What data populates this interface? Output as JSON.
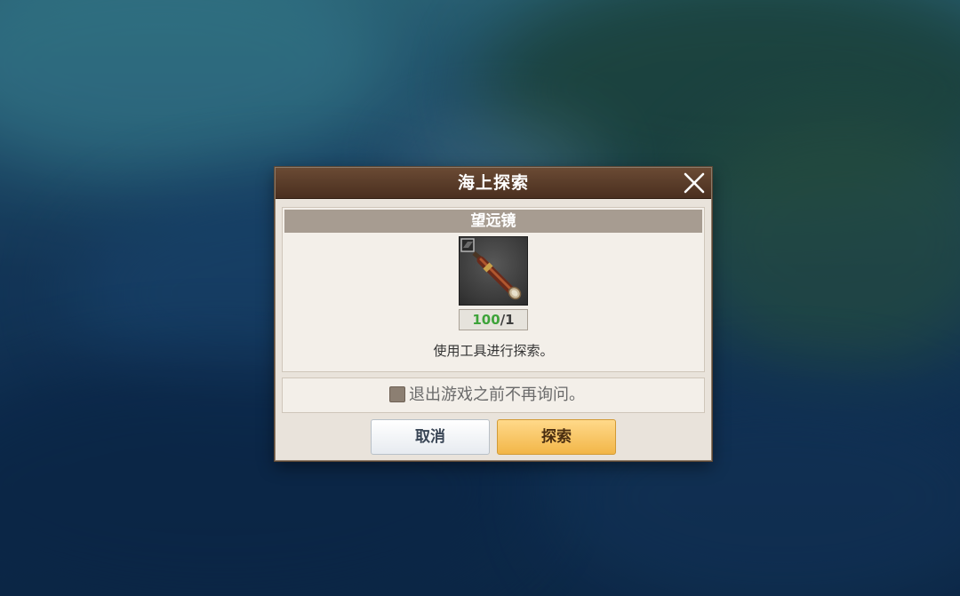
{
  "dialog": {
    "title": "海上探索",
    "close_icon": "close-x-icon",
    "item": {
      "name": "望远镜",
      "icon": "telescope-icon",
      "count_have": "100",
      "count_sep": "/",
      "count_need": "1",
      "description": "使用工具进行探索。"
    },
    "option": {
      "label": "退出游戏之前不再询问。",
      "checked": false
    },
    "buttons": {
      "cancel": "取消",
      "confirm": "探索"
    }
  },
  "colors": {
    "header": "#4a2f1f",
    "item_bar": "#a79c91",
    "count_have": "#3ea33a",
    "confirm_button": "#f2b648"
  }
}
